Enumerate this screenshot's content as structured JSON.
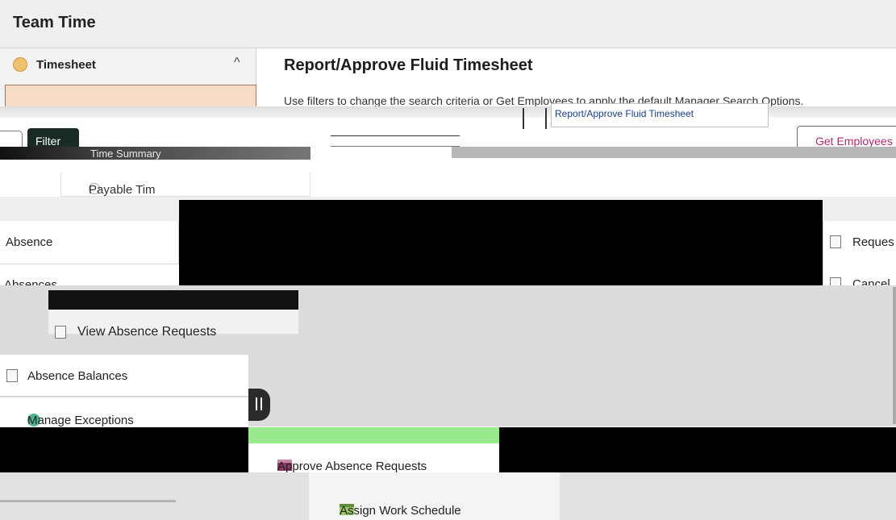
{
  "window": {
    "title": "Team Time"
  },
  "sidebar": {
    "section_label": "Timesheet",
    "expanded": true,
    "icons": {
      "section": "timesheet-icon",
      "toggle": "chevron-up-icon"
    }
  },
  "main": {
    "heading": "Report/Approve Fluid Timesheet",
    "instructions": "Use filters to change the search criteria or Get Employees to apply the default Manager Search Options.",
    "tooltip": "Report/Approve Fluid Timesheet"
  },
  "toolbar": {
    "filter_label": "Filter",
    "get_employees_label": "Get Employees"
  },
  "tiles": {
    "time_summary": "Time Summary",
    "payable_time": "Payable Tim",
    "absence": "Absence",
    "absences": "Absences",
    "request": "Reques",
    "cancel": "Cancel",
    "view_absence_requests": "View Absence Requests",
    "absence_balances": "Absence Balances",
    "manage_exceptions": "Manage Exceptions",
    "approve_absence_requests": "Approve Absence Requests",
    "assign_work_schedule": "Assign Work Schedule"
  },
  "colors": {
    "title_bar": "#efefef",
    "selected_tile": "#f6dcc6",
    "filter_button": "#1a2b27",
    "get_employees_text": "#b4296b",
    "green_tab": "#99ea8d"
  }
}
